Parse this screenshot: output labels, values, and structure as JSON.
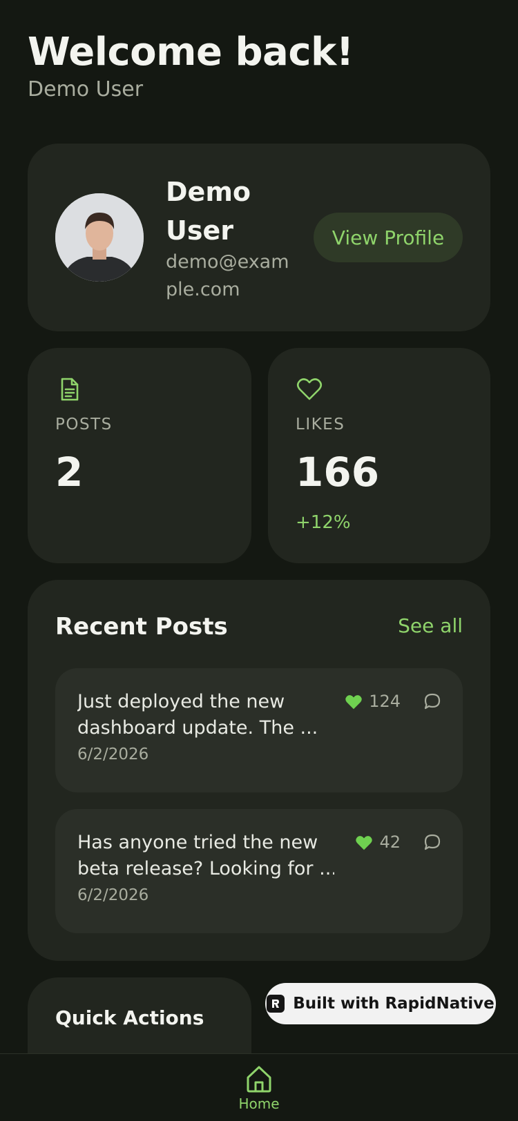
{
  "header": {
    "title": "Welcome back!",
    "subtitle": "Demo User"
  },
  "profile": {
    "name": "Demo User",
    "email": "demo@example.com",
    "view_profile_label": "View Profile"
  },
  "stats": {
    "posts": {
      "label": "POSTS",
      "value": "2"
    },
    "likes": {
      "label": "LIKES",
      "value": "166",
      "delta": "+12%"
    }
  },
  "recent_posts": {
    "title": "Recent Posts",
    "see_all_label": "See all",
    "items": [
      {
        "line1": "Just deployed the new",
        "line2": "dashboard update. The ...",
        "date": "6/2/2026",
        "likes": "124"
      },
      {
        "line1": "Has anyone tried the new",
        "line2": "beta release? Looking for ...",
        "date": "6/2/2026",
        "likes": "42"
      }
    ]
  },
  "quick_actions": {
    "title": "Quick Actions"
  },
  "badge": {
    "label": "Built with RapidNative"
  },
  "tabbar": {
    "home_label": "Home"
  },
  "colors": {
    "background": "#141812",
    "card": "#22261f",
    "accent": "#8fd46b",
    "muted_text": "#a9ad9f"
  },
  "icons": [
    "document-icon",
    "heart-outline-icon",
    "heart-filled-icon",
    "comment-icon",
    "home-icon",
    "rapidnative-logo-icon"
  ]
}
